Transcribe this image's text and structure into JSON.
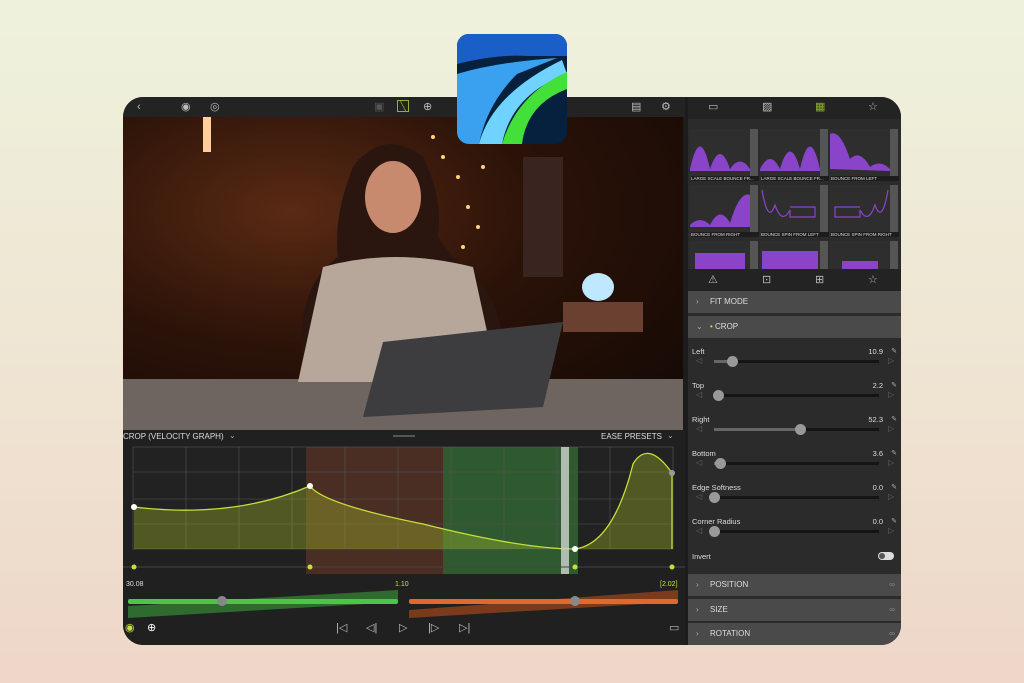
{
  "graph": {
    "title": "CROP (VELOCITY GRAPH)",
    "ease_presets": "EASE PRESETS",
    "start_value": "30.08",
    "mid_value": "1.10",
    "end_value": "[2.02]"
  },
  "presets": [
    {
      "label": "LARGE SCALE BOUNCE FR..."
    },
    {
      "label": "LARGE SCALE BOUNCE FR..."
    },
    {
      "label": "BOUNCE FROM LEFT"
    },
    {
      "label": "BOUNCE FROM RIGHT"
    },
    {
      "label": "BOUNCE SPIN FROM LEFT"
    },
    {
      "label": "BOUNCE SPIN FROM RIGHT"
    },
    {
      "label": ""
    },
    {
      "label": ""
    },
    {
      "label": ""
    }
  ],
  "sections": {
    "fit_mode": "FIT MODE",
    "crop": "CROP",
    "position": "POSITION",
    "size": "SIZE",
    "rotation": "ROTATION"
  },
  "crop_params": [
    {
      "label": "Left",
      "value": "10.9",
      "max": 100
    },
    {
      "label": "Top",
      "value": "2.2",
      "max": 100
    },
    {
      "label": "Right",
      "value": "52.3",
      "max": 100
    },
    {
      "label": "Bottom",
      "value": "3.6",
      "max": 100
    },
    {
      "label": "Edge Softness",
      "value": "0.0",
      "max": 100
    },
    {
      "label": "Corner Radius",
      "value": "0.0",
      "max": 100
    }
  ],
  "invert": {
    "label": "Invert",
    "on": false
  },
  "colors": {
    "accent": "#c5e03a",
    "preset_purple": "#8a44c9",
    "ease_in": "#4fc44a",
    "ease_out": "#e06a2e"
  }
}
